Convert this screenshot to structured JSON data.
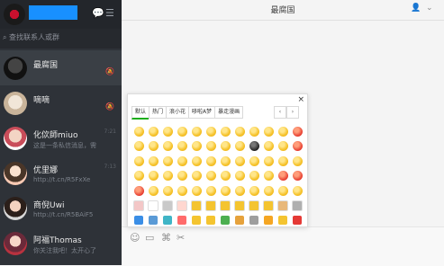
{
  "sidebar": {
    "search_placeholder": "查找联系人或群",
    "contacts": [
      {
        "name": "最腐国",
        "message": "",
        "time": "",
        "muted": true,
        "active": true
      },
      {
        "name": "嘀嘀",
        "message": "",
        "time": "",
        "muted": true,
        "active": false
      },
      {
        "name": "化佽師miuo",
        "message": "这是一条私信消息，需…",
        "time": "7:21",
        "muted": false,
        "active": false
      },
      {
        "name": "优里娜",
        "message": "http://t.cn/R5FxXe",
        "time": "7:13",
        "muted": false,
        "active": false
      },
      {
        "name": "商倪Uwi",
        "message": "http://t.cn/R5BAiF5",
        "time": "",
        "muted": false,
        "active": false
      },
      {
        "name": "阿福Thomas",
        "message": "你关注我吧！太开心了",
        "time": "",
        "muted": false,
        "active": false
      }
    ]
  },
  "chat": {
    "title": "最腐国"
  },
  "emoji_panel": {
    "tabs": [
      "默认",
      "热门",
      "浪小花",
      "哆啦A梦",
      "暴走漫画"
    ],
    "active_tab": "默认",
    "prev": "‹",
    "next": "›",
    "close": "×"
  },
  "colors": {
    "sidebar_bg": "#2e3238",
    "accent_blue": "#1890ff",
    "active_tab_underline": "#1aad19"
  },
  "icons": {
    "header": [
      "chat-bubble-icon",
      "menu-icon"
    ],
    "topbar": [
      "add-user-icon",
      "chevron-down-icon"
    ],
    "toolbar": [
      "emoji-icon",
      "image-icon",
      "attachment-icon",
      "scissors-icon"
    ]
  }
}
